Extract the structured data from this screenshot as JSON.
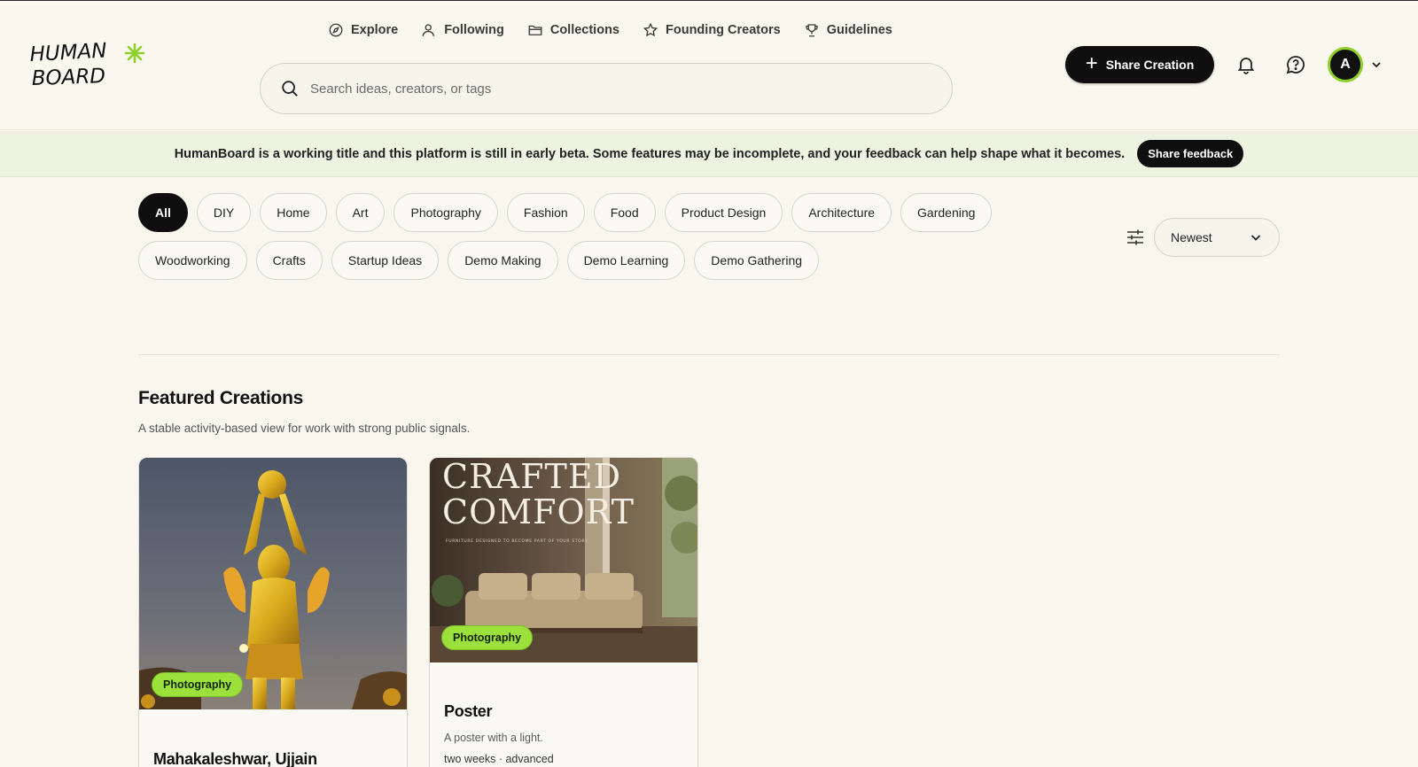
{
  "brand": {
    "logo_line1": "HUMAN",
    "logo_line2": "BOARD",
    "accent": "#8fd12a"
  },
  "nav": [
    {
      "label": "Explore",
      "icon": "compass-icon"
    },
    {
      "label": "Following",
      "icon": "users-icon"
    },
    {
      "label": "Collections",
      "icon": "folder-icon"
    },
    {
      "label": "Founding Creators",
      "icon": "star-icon"
    },
    {
      "label": "Guidelines",
      "icon": "trophy-icon"
    }
  ],
  "search": {
    "placeholder": "Search ideas, creators, or tags",
    "value": ""
  },
  "header": {
    "share_label": "Share Creation",
    "avatar_initial": "A"
  },
  "banner": {
    "text": "HumanBoard is a working title and this platform is still in early beta. Some features may be incomplete, and your feedback can help shape what it becomes.",
    "button": "Share feedback"
  },
  "categories": [
    "All",
    "DIY",
    "Home",
    "Art",
    "Photography",
    "Fashion",
    "Food",
    "Product Design",
    "Architecture",
    "Gardening",
    "Woodworking",
    "Crafts",
    "Startup Ideas",
    "Demo Making",
    "Demo Learning",
    "Demo Gathering"
  ],
  "active_category": "All",
  "sort": {
    "selected": "Newest"
  },
  "featured": {
    "title": "Featured Creations",
    "subtitle": "A stable activity-based view for work with strong public signals."
  },
  "cards": [
    {
      "tag": "Photography",
      "title": "Mahakaleshwar, Ujjain",
      "description": "",
      "meta": ""
    },
    {
      "tag": "Photography",
      "title": "Poster",
      "description": "A poster with a light.",
      "meta": "two weeks · advanced",
      "image_text_line1": "CRAFTED",
      "image_text_line2": "COMFORT",
      "image_text_small": "FURNITURE DESIGNED TO BECOME PART OF YOUR STORY"
    }
  ]
}
